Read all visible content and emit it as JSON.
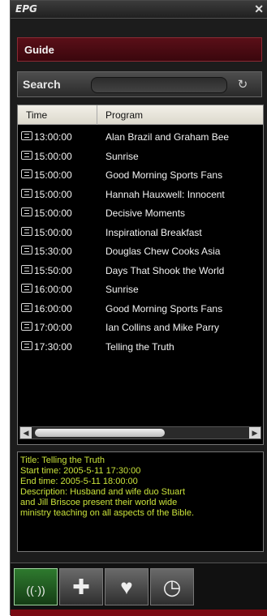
{
  "window": {
    "title": "EPG",
    "close_glyph": "✕"
  },
  "guide": {
    "label": "Guide"
  },
  "search": {
    "label": "Search",
    "value": "",
    "go_glyph": "↻"
  },
  "program_list": {
    "columns": [
      "Time",
      "Program"
    ],
    "rows": [
      {
        "time": "13:00:00",
        "program": "Alan Brazil and Graham Bee"
      },
      {
        "time": "15:00:00",
        "program": "Sunrise"
      },
      {
        "time": "15:00:00",
        "program": "Good Morning Sports Fans"
      },
      {
        "time": "15:00:00",
        "program": "Hannah Hauxwell: Innocent"
      },
      {
        "time": "15:00:00",
        "program": "Decisive Moments"
      },
      {
        "time": "15:00:00",
        "program": "Inspirational Breakfast"
      },
      {
        "time": "15:30:00",
        "program": "Douglas Chew Cooks Asia"
      },
      {
        "time": "15:50:00",
        "program": "Days That Shook the World"
      },
      {
        "time": "16:00:00",
        "program": "Sunrise"
      },
      {
        "time": "16:00:00",
        "program": "Good Morning Sports Fans"
      },
      {
        "time": "17:00:00",
        "program": "Ian Collins and Mike Parry"
      },
      {
        "time": "17:30:00",
        "program": "Telling the Truth"
      }
    ],
    "icon": "tv-icon"
  },
  "details": {
    "title": "Title: Telling the Truth",
    "start": "Start time: 2005-5-11 17:30:00",
    "end": "End time: 2005-5-11 18:00:00",
    "desc1": "Description: Husband and wife duo Stuart",
    "desc2": "and Jill Briscoe present their world wide",
    "desc3": "ministry teaching on all aspects of the Bible."
  },
  "tabs": [
    {
      "name": "broadcast",
      "icon": "broadcast-icon",
      "glyph": "((·))",
      "active": true
    },
    {
      "name": "plugins",
      "icon": "puzzle-icon",
      "glyph": "✚",
      "active": false
    },
    {
      "name": "favorites",
      "icon": "heart-icon",
      "glyph": "♥",
      "active": false
    },
    {
      "name": "schedule",
      "icon": "clock-icon",
      "glyph": "◷",
      "active": false
    }
  ],
  "colors": {
    "accent_red": "#5a0f18",
    "detail_text": "#c9e23a",
    "active_tab": "#2e7a2e"
  }
}
